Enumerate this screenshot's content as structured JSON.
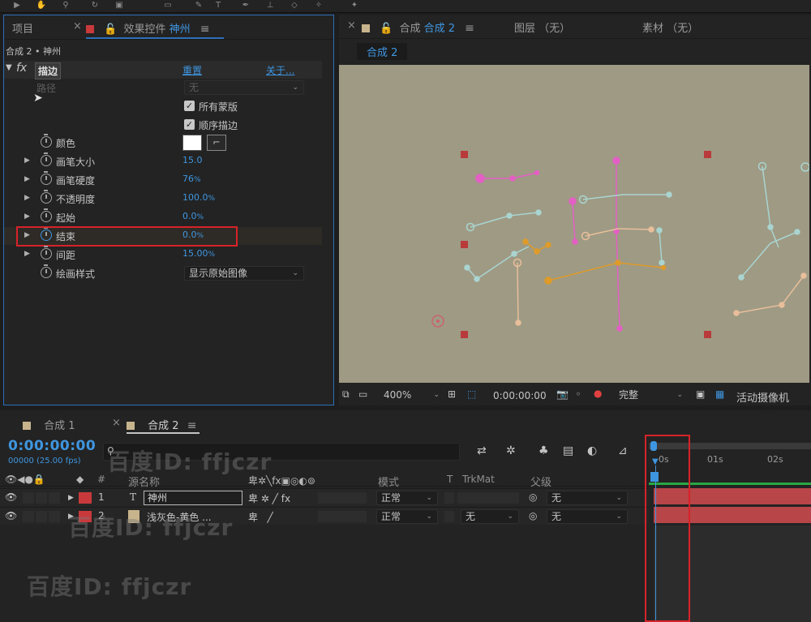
{
  "effects_panel": {
    "tabs": [
      {
        "label": "项目"
      },
      {
        "label_prefix": "效果控件",
        "label_target": "神州"
      }
    ],
    "breadcrumb": "合成 2 • 神州",
    "effect": {
      "name": "描边",
      "reset_label": "重置",
      "about_label": "关于...",
      "path_label": "路径",
      "path_value": "无",
      "all_masks_label": "所有蒙版",
      "sequential_label": "顺序描边",
      "params": [
        {
          "name": "颜色",
          "value": ""
        },
        {
          "name": "画笔大小",
          "value": "15.0"
        },
        {
          "name": "画笔硬度",
          "value": "76",
          "unit": "%"
        },
        {
          "name": "不透明度",
          "value": "100.0",
          "unit": "%"
        },
        {
          "name": "起始",
          "value": "0.0",
          "unit": "%"
        },
        {
          "name": "结束",
          "value": "0.0",
          "unit": "%"
        },
        {
          "name": "间距",
          "value": "15.00",
          "unit": "%"
        },
        {
          "name": "绘画样式",
          "value": "显示原始图像"
        }
      ]
    }
  },
  "comp_panel": {
    "tabs": [
      {
        "label_prefix": "合成",
        "label_target": "合成 2"
      },
      {
        "label": "图层 （无）"
      },
      {
        "label": "素材 （无）"
      }
    ],
    "subtab": "合成 2",
    "bottom": {
      "zoom": "400%",
      "timecode": "0:00:00:00",
      "resolution": "完整",
      "camera": "活动摄像机"
    }
  },
  "timeline": {
    "tabs": [
      {
        "label": "合成 1"
      },
      {
        "label": "合成 2"
      }
    ],
    "current_time": "0:00:00:00",
    "fps_text": "00000 (25.00 fps)",
    "columns": {
      "number": "#",
      "source_name": "源名称",
      "mode": "模式",
      "t": "T",
      "trkmat": "TrkMat",
      "parent": "父级"
    },
    "ruler_labels": [
      "0s",
      "01s",
      "02s"
    ],
    "layers": [
      {
        "index": "1",
        "type": "T",
        "name": "神州",
        "mode": "正常",
        "trkmat": "",
        "parent": "无"
      },
      {
        "index": "2",
        "type": "",
        "name": "浅灰色-黄色 ...",
        "mode": "正常",
        "trkmat": "无",
        "parent": "无"
      }
    ]
  },
  "watermarks": [
    "百度ID: ffjczr",
    "百度ID: ffjczr",
    "百度ID: ffjczr"
  ],
  "colors": {
    "accent_blue": "#3f96e0",
    "layer_red": "#c8393c",
    "layer_tan": "#c8b48c",
    "canvas_bg": "#9e9a84",
    "highlight_red": "#d8222a"
  }
}
